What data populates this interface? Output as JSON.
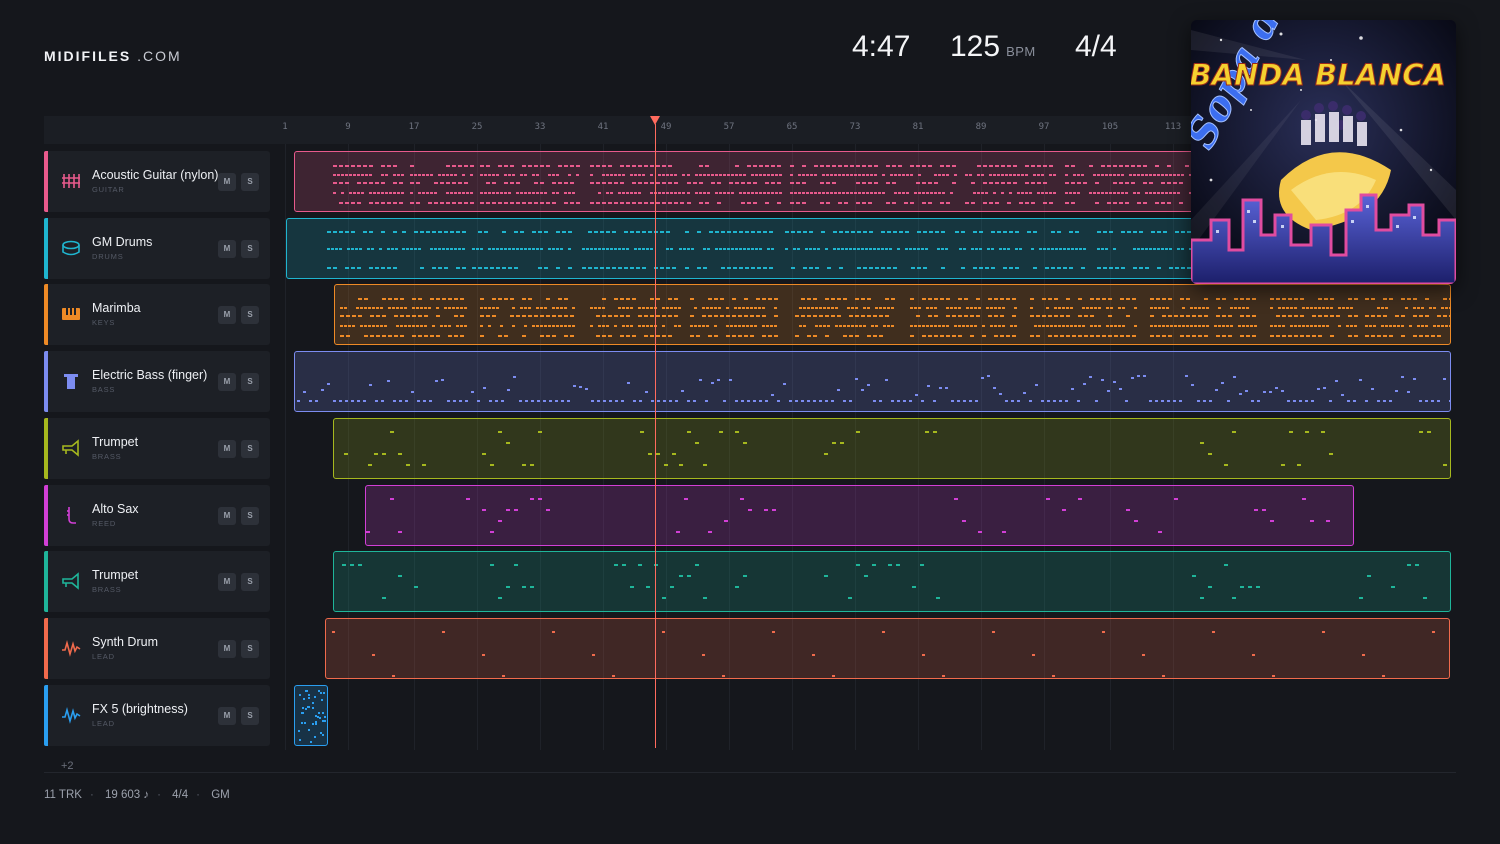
{
  "brand": {
    "name": "MIDIFILES",
    "suffix": ".COM"
  },
  "stats": {
    "duration": "4:47",
    "tempo": "125",
    "tempo_unit": "BPM",
    "time_signature": "4/4"
  },
  "ruler": {
    "ticks": [
      "1",
      "9",
      "17",
      "25",
      "33",
      "41",
      "49",
      "57",
      "65",
      "73",
      "81",
      "89",
      "97",
      "105",
      "113"
    ]
  },
  "colors": {
    "accent_playhead": "#ff6b5e",
    "background": "#15171c"
  },
  "tracks": [
    {
      "name": "Acoustic Guitar (nylon)",
      "category": "GUITAR",
      "icon": "guitar-icon",
      "color": "#e85a8c",
      "mute": "M",
      "solo": "S"
    },
    {
      "name": "GM Drums",
      "category": "DRUMS",
      "icon": "drum-icon",
      "color": "#1fb5cf",
      "mute": "M",
      "solo": "S"
    },
    {
      "name": "Marimba",
      "category": "KEYS",
      "icon": "keys-icon",
      "color": "#ee8a26",
      "mute": "M",
      "solo": "S"
    },
    {
      "name": "Electric Bass (finger)",
      "category": "BASS",
      "icon": "bass-icon",
      "color": "#7c8cf0",
      "mute": "M",
      "solo": "S"
    },
    {
      "name": "Trumpet",
      "category": "BRASS",
      "icon": "trumpet-icon",
      "color": "#a6b81e",
      "mute": "M",
      "solo": "S"
    },
    {
      "name": "Alto Sax",
      "category": "REED",
      "icon": "sax-icon",
      "color": "#d23fd6",
      "mute": "M",
      "solo": "S"
    },
    {
      "name": "Trumpet",
      "category": "BRASS",
      "icon": "trumpet-icon",
      "color": "#1fb59a",
      "mute": "M",
      "solo": "S"
    },
    {
      "name": "Synth Drum",
      "category": "LEAD",
      "icon": "wave-icon",
      "color": "#f06a4c",
      "mute": "M",
      "solo": "S"
    },
    {
      "name": "FX 5 (brightness)",
      "category": "LEAD",
      "icon": "wave-icon",
      "color": "#2a9ef0",
      "mute": "M",
      "solo": "S"
    }
  ],
  "more_tracks": "+2",
  "footer": {
    "tracks": "11 TRK",
    "notes": "19 603 ♪",
    "time_signature": "4/4",
    "standard": "GM"
  },
  "cover_art": {
    "title": "BANDA BLANCA",
    "script_text": "Sopa de Caracol"
  }
}
